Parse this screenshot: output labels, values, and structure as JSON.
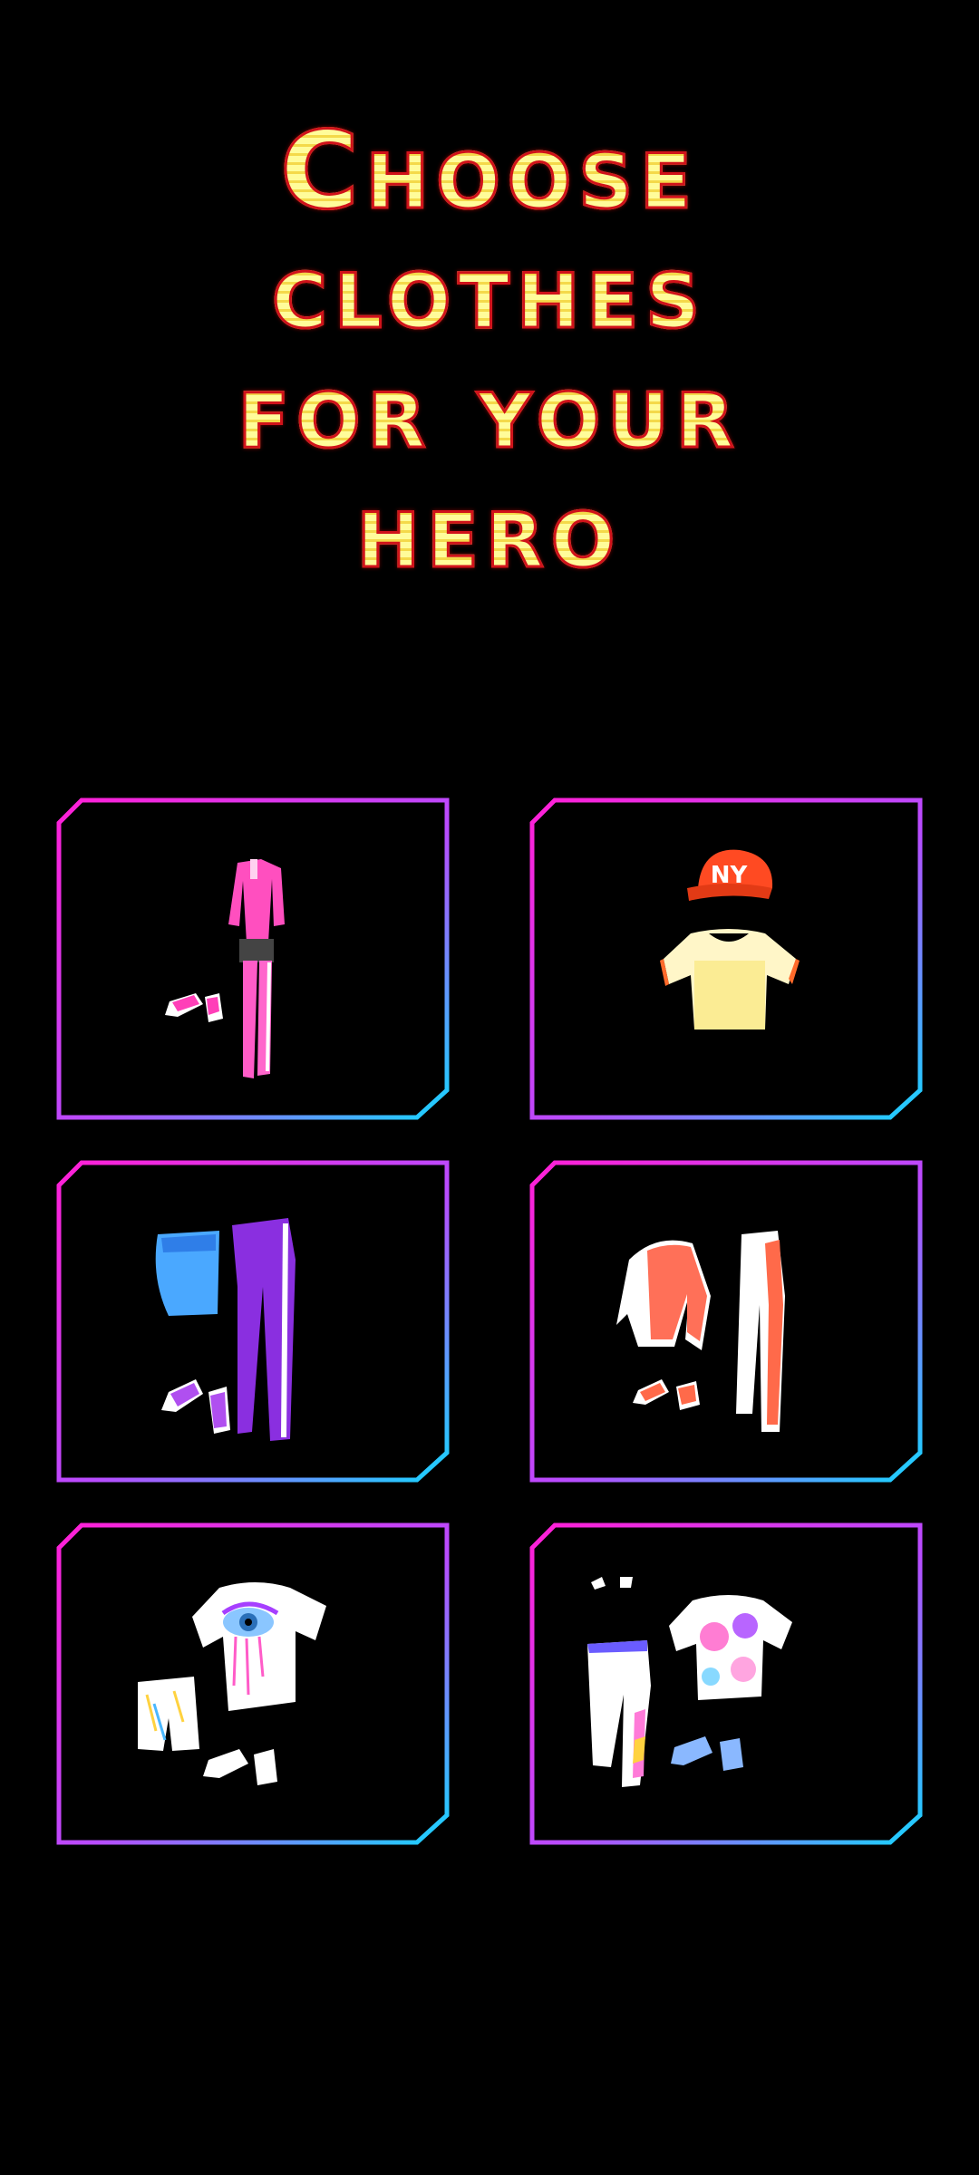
{
  "title": {
    "lines": [
      "Choose",
      "clothes",
      "for your",
      "hero"
    ]
  },
  "outfits": [
    {
      "icon": "pink-jumpsuit-outfit-icon"
    },
    {
      "icon": "red-cap-tee-outfit-icon"
    },
    {
      "icon": "purple-leggings-outfit-icon"
    },
    {
      "icon": "coral-sweater-outfit-icon"
    },
    {
      "icon": "eye-print-tee-outfit-icon"
    },
    {
      "icon": "tie-dye-outfit-icon"
    }
  ],
  "colors": {
    "background": "#000000",
    "title_fill": "#fff27a",
    "title_stroke": "#d0121a",
    "frame_magenta": "#ff1fd6",
    "frame_cyan": "#18d4ff"
  }
}
